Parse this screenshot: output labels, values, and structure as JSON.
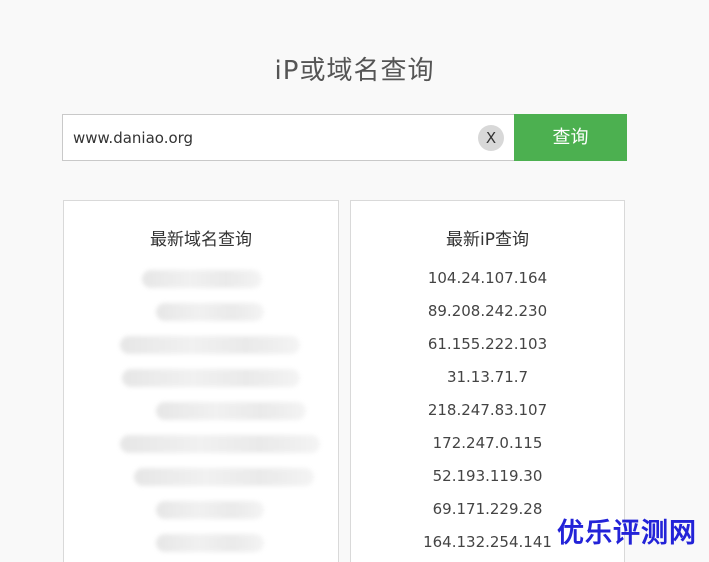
{
  "page": {
    "title": "iP或域名查询"
  },
  "search": {
    "value": "www.daniao.org",
    "clear_label": "X",
    "button_label": "查询"
  },
  "latest_domains": {
    "title": "最新域名查询"
  },
  "latest_ips": {
    "title": "最新iP查询",
    "items": [
      "104.24.107.164",
      "89.208.242.230",
      "61.155.222.103",
      "31.13.71.7",
      "218.247.83.107",
      "172.247.0.115",
      "52.193.119.30",
      "69.171.229.28",
      "164.132.254.141"
    ]
  },
  "watermark": {
    "text": "优乐评测网"
  },
  "colors": {
    "accent": "#4cb050",
    "watermark": "#2323d8"
  }
}
